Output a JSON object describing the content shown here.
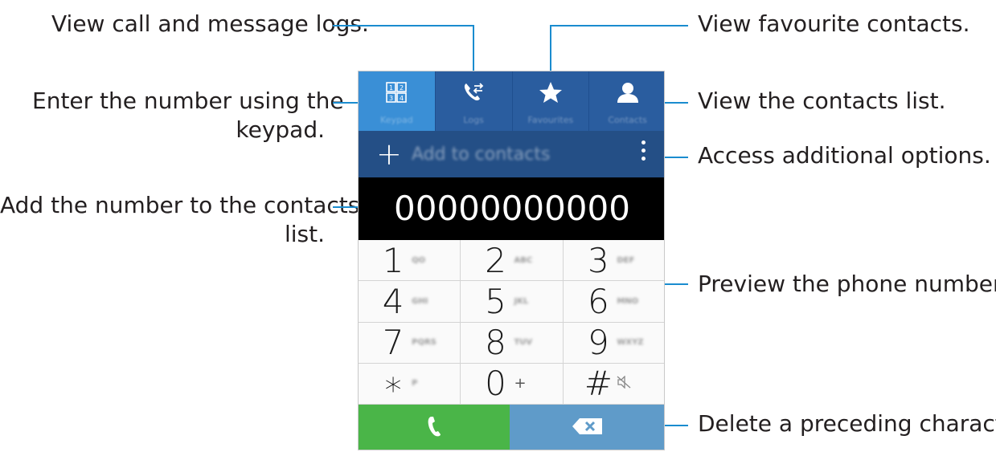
{
  "callouts": {
    "logs": "View call and message logs.",
    "favourites": "View favourite contacts.",
    "keypad_line1": "Enter the number using the",
    "keypad_line2": "keypad.",
    "contacts_list": "View the contacts list.",
    "options": "Access additional options.",
    "add_line1": "Add the number to the contacts",
    "add_line2": "list.",
    "preview": "Preview the phone number.",
    "delete": "Delete a preceding character."
  },
  "tabs": [
    {
      "label": "Keypad",
      "icon": "keypad-icon"
    },
    {
      "label": "Logs",
      "icon": "logs-icon"
    },
    {
      "label": "Favourites",
      "icon": "star-icon"
    },
    {
      "label": "Contacts",
      "icon": "person-icon"
    }
  ],
  "actionbar": {
    "plus": "+",
    "add_label": "Add to contacts"
  },
  "display": {
    "number": "00000000000"
  },
  "keys": [
    {
      "digit": "1",
      "letters": "QO"
    },
    {
      "digit": "2",
      "letters": "ABC"
    },
    {
      "digit": "3",
      "letters": "DEF"
    },
    {
      "digit": "4",
      "letters": "GHI"
    },
    {
      "digit": "5",
      "letters": "JKL"
    },
    {
      "digit": "6",
      "letters": "MNO"
    },
    {
      "digit": "7",
      "letters": "PQRS"
    },
    {
      "digit": "8",
      "letters": "TUV"
    },
    {
      "digit": "9",
      "letters": "WXYZ"
    },
    {
      "digit": "∗",
      "letters": "P"
    },
    {
      "digit": "0",
      "letters": "+"
    },
    {
      "digit": "#",
      "letters": ""
    }
  ],
  "colors": {
    "accent_line": "#1a8ccf",
    "call": "#4ab548",
    "delete": "#5f9bc9",
    "tab_active": "#3a8fd6"
  }
}
